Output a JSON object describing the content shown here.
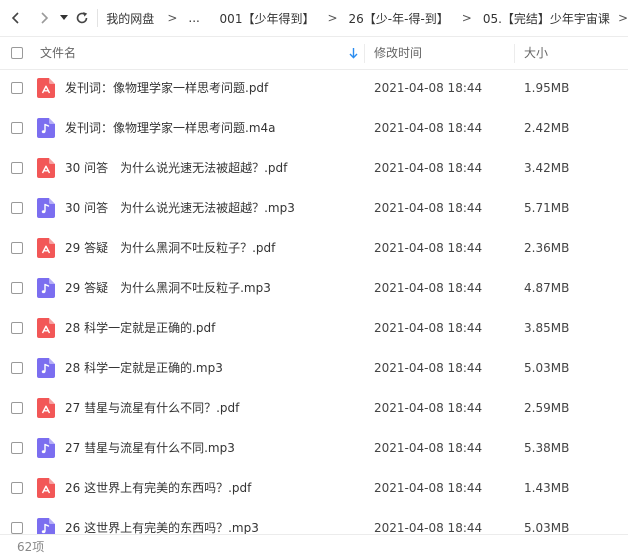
{
  "breadcrumb": {
    "items": [
      "我的网盘",
      "...",
      "001【少年得到】",
      "26【少-年-得-到】",
      "05.【完结】少年宇宙课"
    ],
    "separator": ">"
  },
  "columns": {
    "name": "文件名",
    "modified": "修改时间",
    "size": "大小"
  },
  "files": [
    {
      "name": "发刊词：像物理学家一样思考问题.pdf",
      "date": "2021-04-08 18:44",
      "size": "1.95MB",
      "type": "pdf"
    },
    {
      "name": "发刊词：像物理学家一样思考问题.m4a",
      "date": "2021-04-08 18:44",
      "size": "2.42MB",
      "type": "audio"
    },
    {
      "name": "30 问答　为什么说光速无法被超越？.pdf",
      "date": "2021-04-08 18:44",
      "size": "3.42MB",
      "type": "pdf"
    },
    {
      "name": "30 问答　为什么说光速无法被超越？.mp3",
      "date": "2021-04-08 18:44",
      "size": "5.71MB",
      "type": "audio"
    },
    {
      "name": "29 答疑　为什么黑洞不吐反粒子？.pdf",
      "date": "2021-04-08 18:44",
      "size": "2.36MB",
      "type": "pdf"
    },
    {
      "name": "29 答疑　为什么黑洞不吐反粒子.mp3",
      "date": "2021-04-08 18:44",
      "size": "4.87MB",
      "type": "audio"
    },
    {
      "name": "28 科学一定就是正确的.pdf",
      "date": "2021-04-08 18:44",
      "size": "3.85MB",
      "type": "pdf"
    },
    {
      "name": "28 科学一定就是正确的.mp3",
      "date": "2021-04-08 18:44",
      "size": "5.03MB",
      "type": "audio"
    },
    {
      "name": "27 彗星与流星有什么不同？.pdf",
      "date": "2021-04-08 18:44",
      "size": "2.59MB",
      "type": "pdf"
    },
    {
      "name": "27 彗星与流星有什么不同.mp3",
      "date": "2021-04-08 18:44",
      "size": "5.38MB",
      "type": "audio"
    },
    {
      "name": "26 这世界上有完美的东西吗？.pdf",
      "date": "2021-04-08 18:44",
      "size": "1.43MB",
      "type": "pdf"
    },
    {
      "name": "26 这世界上有完美的东西吗？.mp3",
      "date": "2021-04-08 18:44",
      "size": "5.03MB",
      "type": "audio"
    }
  ],
  "footer": {
    "count": "62项"
  },
  "colors": {
    "pdf": "#f25757",
    "audio": "#7b6ef0",
    "accent": "#2b8df0"
  }
}
